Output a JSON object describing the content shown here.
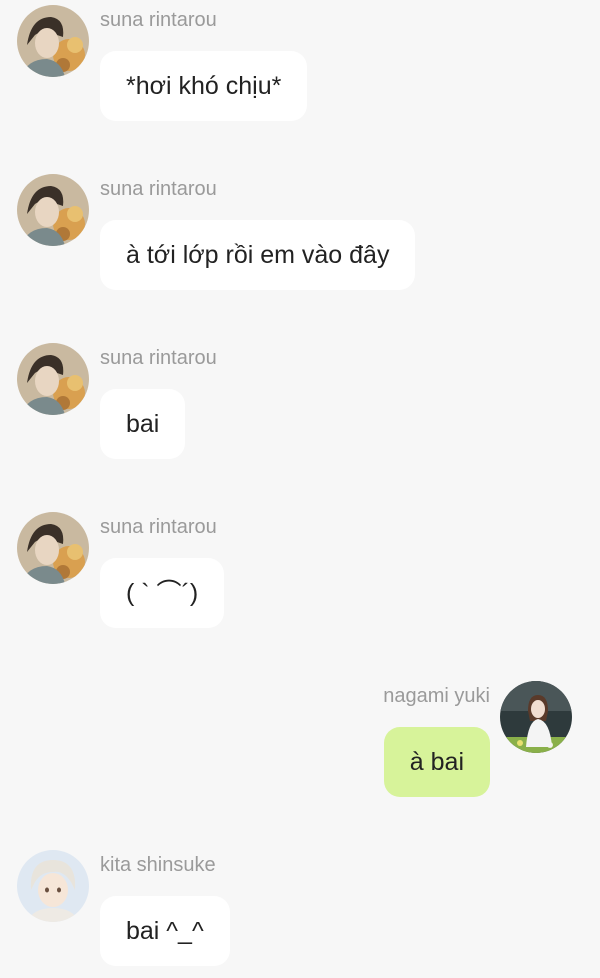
{
  "messages": [
    {
      "sender": "suna rintarou",
      "text": "*hơi khó chịu*",
      "side": "in",
      "avatar": "suna-avatar"
    },
    {
      "sender": "suna rintarou",
      "text": "à tới lớp rồi em vào đây",
      "side": "in",
      "avatar": "suna-avatar"
    },
    {
      "sender": "suna rintarou",
      "text": "bai",
      "side": "in",
      "avatar": "suna-avatar"
    },
    {
      "sender": "suna rintarou",
      "text": "( ` ⌒´)",
      "side": "in",
      "avatar": "suna-avatar"
    },
    {
      "sender": "nagami yuki",
      "text": "à bai",
      "side": "out",
      "avatar": "nagami-avatar"
    },
    {
      "sender": "kita shinsuke",
      "text": "bai ^_^",
      "side": "in",
      "avatar": "kita-avatar"
    }
  ],
  "colors": {
    "background": "#f7f7f7",
    "incoming_bubble": "#ffffff",
    "outgoing_bubble": "#d7f39a",
    "sender_name": "#9a9a9a"
  }
}
